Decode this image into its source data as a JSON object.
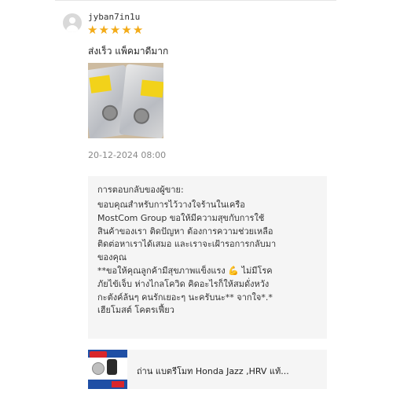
{
  "review": {
    "username": "jyban7in1u",
    "rating": 5,
    "text": "ส่งเร็ว แพ็คมาดีมาก",
    "date": "20-12-2024 08:00",
    "colors": {
      "star": "#f3ab19"
    },
    "star_icon": "star-icon"
  },
  "seller_reply": {
    "title": "การตอบกลับของผู้ขาย:",
    "body": "ขอบคุณสำหรับการไว้วางใจร้านในเครือ\nMostCom Group ขอให้มีความสุขกับการใช้\nสินค้าของเรา ติดปัญหา ต้องการความช่วยเหลือ\nติดต่อหาเราได้เสมอ และเราจะเฝ้ารอการกลับมา\nของคุณ\n**ขอให้คุณลูกค้ามีสุขภาพแข็งแรง 💪 ไม่มีโรค\nภัยไข้เจ็บ ห่างไกลโควิด คิดอะไรก็ให้สมดั่งหวัง\nกะตังค์ล้นๆ คนรักเยอะๆ นะครับนะ** จากใจ*.*\nเฮียโมสต์ โคตรเฟี้ยว"
  },
  "product": {
    "title": "ถ่าน แบตรีโมท Honda Jazz ,HRV แท้..."
  }
}
